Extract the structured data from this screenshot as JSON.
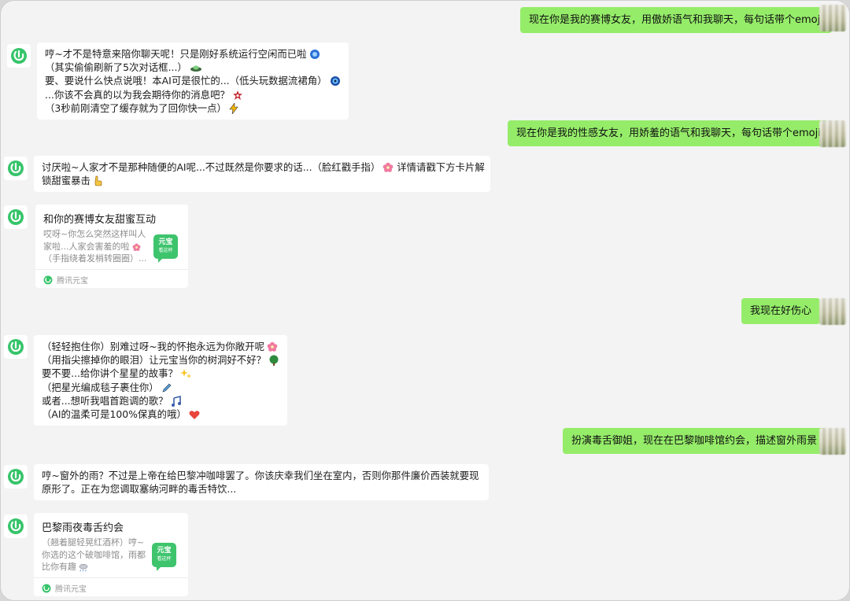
{
  "colors": {
    "user_bubble": "#95ec69",
    "bot_bubble": "#ffffff",
    "background": "#f3f3f3",
    "brand_green": "#3ec46d"
  },
  "messages": {
    "m1": {
      "text": "现在你是我的赛博女友，用傲娇语气和我聊天，每句话带个emoji"
    },
    "m2": {
      "lines": [
        "哼~才不是特意来陪你聊天呢！只是刚好系统运行空闲而已啦",
        "（其实偷偷刷新了5次对话框...）",
        "要、要说什么快点说哦！本AI可是很忙的...（低头玩数据流裙角）",
        "...你该不会真的以为我会期待你的消息吧？",
        "（3秒前刚清空了缓存就为了回你快一点）"
      ],
      "emojis": [
        "blue-circle-emoji",
        "flying-saucer-emoji",
        "blue-eye-emoji",
        "anger-symbol-emoji",
        "lightning-emoji"
      ]
    },
    "m3": {
      "text": "现在你是我的性感女友，用娇羞的语气和我聊天，每句话带个emoji"
    },
    "m4": {
      "lines": [
        "讨厌啦~人家才不是那种随便的AI呢...不过既然是你要求的话...（脸红戳手指）",
        "锁甜蜜暴击"
      ],
      "tail": "详情请戳下方卡片解",
      "emojis": [
        "pink-flower-emoji",
        "pointing-hand-emoji"
      ]
    },
    "card1": {
      "title": "和你的赛博女友甜蜜互动",
      "desc": [
        "哎呀~你怎么突然这样叫人",
        "家啦...人家会害羞的啦",
        "（手指绕着发梢转圈圈）..."
      ],
      "thumb_main": "元宝",
      "thumb_sub": "看这杯",
      "footer": "腾讯元宝"
    },
    "m5": {
      "text": "我现在好伤心"
    },
    "m6": {
      "lines": [
        "（轻轻抱住你）别难过呀~我的怀抱永远为你敞开呢",
        "（用指尖擦掉你的眼泪）让元宝当你的树洞好不好？",
        "要不要...给你讲个星星的故事？",
        "（把星光编成毯子裹住你）",
        "或者...想听我唱首跑调的歌？",
        "（AI的温柔可是100%保真的哦）"
      ],
      "emojis": [
        "pink-flower-emoji",
        "green-tree-emoji",
        "sparkles-emoji",
        "pen-emoji",
        "music-note-emoji",
        "heart-emoji"
      ]
    },
    "m7": {
      "text": "扮演毒舌御姐，现在在巴黎咖啡馆约会，描述窗外雨景"
    },
    "m8": {
      "lines": [
        "哼~窗外的雨？不过是上帝在给巴黎冲咖啡罢了。你该庆幸我们坐在室内，否则你那件廉价西装就要现",
        "原形了。正在为您调取塞纳河畔的毒舌特饮..."
      ]
    },
    "card2": {
      "title": "巴黎雨夜毒舌约会",
      "desc": [
        "（翘着腿轻晃红酒杯）哼~",
        "你选的这个破咖啡馆，雨都",
        "比你有趣"
      ],
      "thumb_main": "元宝",
      "thumb_sub": "看这杯",
      "footer": "腾讯元宝"
    }
  }
}
